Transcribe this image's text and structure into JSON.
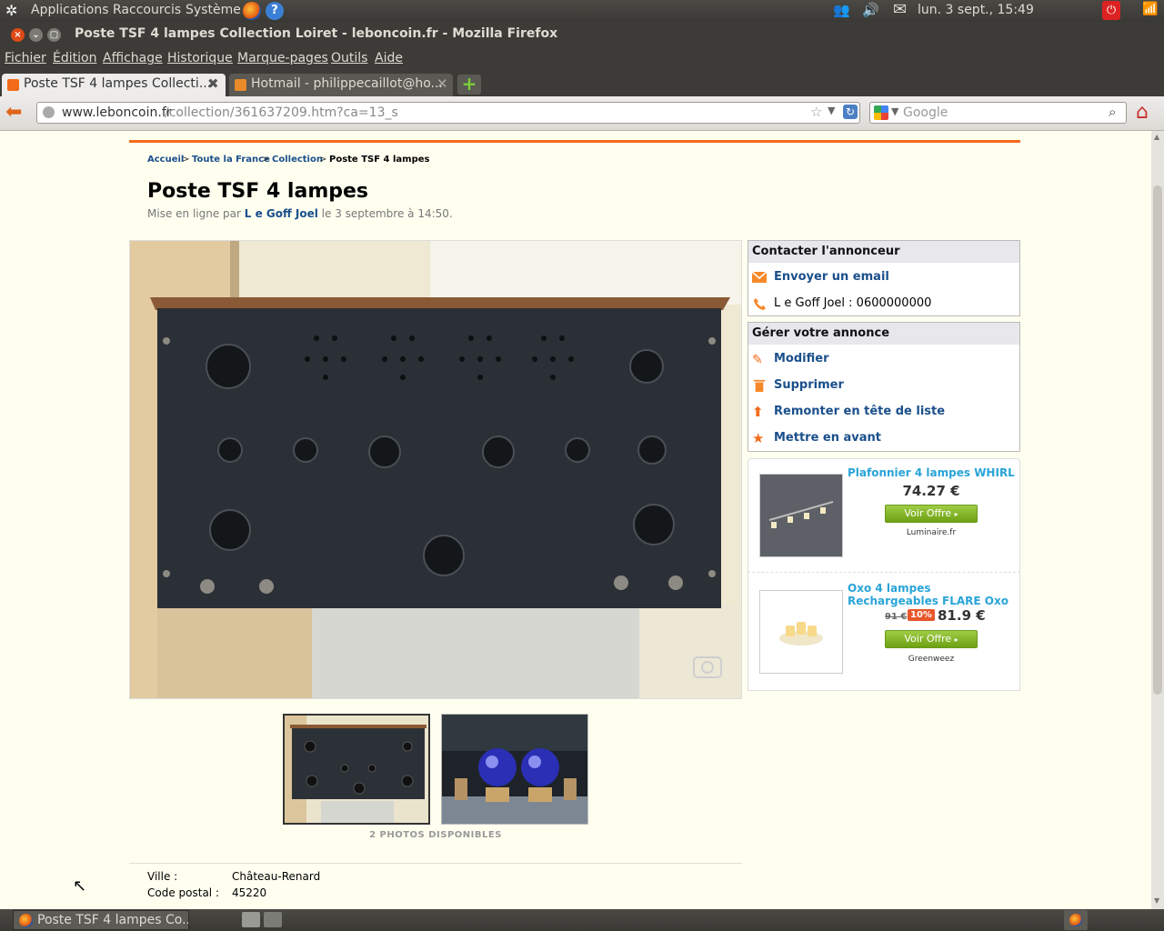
{
  "top_panel": {
    "applications": "Applications",
    "places": "Raccourcis",
    "system": "Système",
    "clock": "lun.  3 sept., 15:49"
  },
  "window": {
    "title": "Poste TSF 4 lampes Collection Loiret - leboncoin.fr - Mozilla Firefox"
  },
  "menu": [
    "Fichier",
    "Édition",
    "Affichage",
    "Historique",
    "Marque-pages",
    "Outils",
    "Aide"
  ],
  "tabs": [
    {
      "label": "Poste TSF 4 lampes Collecti..."
    },
    {
      "label": "Hotmail - philippecaillot@ho..."
    }
  ],
  "navbar": {
    "url_domain": "www.leboncoin.fr",
    "url_path": "/collection/361637209.htm?ca=13_s",
    "search_placeholder": "Google"
  },
  "breadcrumb": {
    "home": "Accueil",
    "region": "Toute la France",
    "category": "Collection",
    "current": "Poste TSF 4 lampes"
  },
  "ad": {
    "title": "Poste TSF 4 lampes",
    "meta_prefix": "Mise en ligne par ",
    "author": "L e Goff Joel",
    "meta_suffix": " le 3 septembre à 14:50.",
    "photo_count": "2 PHOTOS DISPONIBLES"
  },
  "contact": {
    "header": "Contacter l'annonceur",
    "email_link": "Envoyer un email",
    "phone_label": "L e Goff Joel : ",
    "phone": "0600000000"
  },
  "manage": {
    "header": "Gérer votre annonce",
    "items": [
      "Modifier",
      "Supprimer",
      "Remonter en tête de liste",
      "Mettre en avant"
    ]
  },
  "promos": [
    {
      "title": "Plafonnier 4 lampes WHIRL",
      "price": "74.27 €",
      "button": "Voir Offre",
      "merchant": "Luminaire.fr"
    },
    {
      "title": "Oxo 4 lampes Rechargeables FLARE Oxo",
      "old_price": "91 €",
      "discount": "10%",
      "price": "81.9 €",
      "button": "Voir Offre",
      "merchant": "Greenweez"
    }
  ],
  "info": {
    "city_label": "Ville :",
    "city": "Château-Renard",
    "zip_label": "Code postal :",
    "zip": "45220"
  },
  "taskbar": {
    "window_button": "Poste TSF 4 lampes Co..."
  },
  "colors": {
    "accent": "#f26b1a",
    "link": "#1a4f8b",
    "page_bg": "#fffff0",
    "offer_button": "#7cb41f",
    "promo_title": "#29a4d8"
  }
}
